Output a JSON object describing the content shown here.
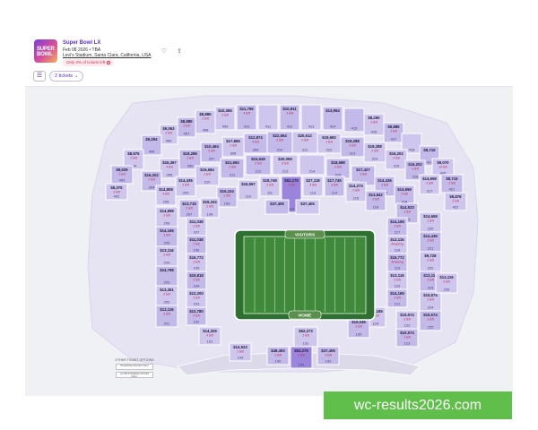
{
  "event": {
    "title": "Super Bowl LX",
    "date": "Feb 08 2026 • TBA",
    "venue": "Levi's Stadium, Santa Clara, California, USA",
    "tickets_left": "Only 3% of tickets left",
    "thumb_text": "SUPER BOWL"
  },
  "toolbar": {
    "ticket_count": "2 tickets"
  },
  "field": {
    "visitors": "VISITORS",
    "home": "HOME"
  },
  "other_options": {
    "title": "OTHER TICKET OPTIONS",
    "options": [
      "STANDING ROOM ONLY",
      "CLUB STANDING ROOM ONLY"
    ]
  },
  "watermark": "wc-results2026.com",
  "colors": {
    "accent": "#5b2bd6",
    "section": "#cfc6ee",
    "section_alt": "#c4bae9",
    "alert": "#c32047",
    "field_green": "#3f8a3a",
    "background": "#eff1f5"
  },
  "sections": [
    {
      "id": "409",
      "price": "$10,365",
      "left": "2 left"
    },
    {
      "id": "410",
      "price": "$11,755",
      "left": "4 left"
    },
    {
      "id": "411",
      "price": "",
      "left": ""
    },
    {
      "id": "412",
      "price": "$10,911",
      "left": "2 left"
    },
    {
      "id": "413",
      "price": "",
      "left": ""
    },
    {
      "id": "414",
      "price": "$13,964",
      "left": ""
    },
    {
      "id": "408",
      "price": "$8,885",
      "left": "2 left"
    },
    {
      "id": "407",
      "price": "$8,885",
      "left": "2 left"
    },
    {
      "id": "406",
      "price": "$9,063",
      "left": "2 left"
    },
    {
      "id": "405",
      "price": "$9,294",
      "left": ""
    },
    {
      "id": "404",
      "price": "$8,976",
      "left": "2 left"
    },
    {
      "id": "403",
      "price": "$8,529",
      "left": "2 left"
    },
    {
      "id": "402",
      "price": "$8,375",
      "left": "2 left"
    },
    {
      "id": "415",
      "price": "",
      "left": ""
    },
    {
      "id": "416",
      "price": "$8,250",
      "left": "2 left"
    },
    {
      "id": "417",
      "price": "$8,885",
      "left": "2 left"
    },
    {
      "id": "418",
      "price": "",
      "left": ""
    },
    {
      "id": "419",
      "price": "$8,715",
      "left": ""
    },
    {
      "id": "420",
      "price": "$9,070",
      "left": "14 left"
    },
    {
      "id": "421",
      "price": "$8,715",
      "left": "2 left"
    },
    {
      "id": "422",
      "price": "$8,878",
      "left": "2 left"
    },
    {
      "id": "310",
      "price": "$22,654",
      "left": "2 left"
    },
    {
      "id": "311",
      "price": "$20,612",
      "left": "2 left"
    },
    {
      "id": "309",
      "price": "$12,874",
      "left": "4 left"
    },
    {
      "id": "308",
      "price": "$17,865",
      "left": "2 left"
    },
    {
      "id": "307",
      "price": "$10,464",
      "left": "2 left"
    },
    {
      "id": "312",
      "price": "$19,692",
      "left": "2 left"
    },
    {
      "id": "313",
      "price": "$19,288",
      "left": "2 left"
    },
    {
      "id": "314",
      "price": "$19,288",
      "left": "2 left"
    },
    {
      "id": "306",
      "price": "$19,288",
      "left": "2 left"
    },
    {
      "id": "305",
      "price": "$16,367",
      "left": "4 left"
    },
    {
      "id": "304",
      "price": "$16,202",
      "left": "2 left"
    },
    {
      "id": "315",
      "price": "$16,202",
      "left": "2 left"
    },
    {
      "id": "316",
      "price": "$16,202",
      "left": "2 left"
    },
    {
      "id": "317",
      "price": "$14,659",
      "left": "2 left"
    },
    {
      "id": "212",
      "price": "$24,549",
      "left": "2 left"
    },
    {
      "id": "213",
      "price": "$30,069",
      "left": "6 left"
    },
    {
      "id": "211",
      "price": "$21,692",
      "left": "2 left"
    },
    {
      "id": "214",
      "price": "",
      "left": ""
    },
    {
      "id": "215",
      "price": "$18,588",
      "left": "2 left"
    },
    {
      "id": "210",
      "price": "$15,684",
      "left": "2 left"
    },
    {
      "id": "216",
      "price": "$17,427",
      "left": "2 left"
    },
    {
      "id": "209",
      "price": "$14,436",
      "left": "2 left"
    },
    {
      "id": "217",
      "price": "$14,436",
      "left": "2 left"
    },
    {
      "id": "208",
      "price": "$14,808",
      "left": "4 left"
    },
    {
      "id": "218",
      "price": "$14,659",
      "left": "2 left"
    },
    {
      "id": "111",
      "price": "$18,749",
      "left": "2 left"
    },
    {
      "id": "112",
      "price": "$52,275",
      "left": "2 left"
    },
    {
      "id": "113",
      "price": "$27,118",
      "left": "2 left"
    },
    {
      "id": "114",
      "price": "$17,745",
      "left": "2 left"
    },
    {
      "id": "110",
      "price": "$16,567",
      "left": ""
    },
    {
      "id": "109",
      "price": "$15,104",
      "left": "2 left"
    },
    {
      "id": "115",
      "price": "$14,273",
      "left": "2 left"
    },
    {
      "id": "116",
      "price": "$13,942",
      "left": "2 left"
    },
    {
      "id": "108",
      "price": "$15,104",
      "left": "2 left"
    },
    {
      "id": "C1",
      "price": "$37,405",
      "left": ""
    },
    {
      "id": "C2",
      "price": "$37,405",
      "left": ""
    },
    {
      "id": "207",
      "price": "$13,715",
      "left": "2 left"
    },
    {
      "id": "206",
      "price": "$14,659",
      "left": "2 left"
    },
    {
      "id": "205",
      "price": "$14,165",
      "left": "2 left"
    },
    {
      "id": "204",
      "price": "$13,116",
      "left": "2 left"
    },
    {
      "id": "203",
      "price": "$24,798",
      "left": ""
    },
    {
      "id": "202",
      "price": "$13,361",
      "left": "2 left"
    },
    {
      "id": "201",
      "price": "$13,116",
      "left": "2 left"
    },
    {
      "id": "107",
      "price": "$11,038",
      "left": "2 left"
    },
    {
      "id": "106",
      "price": "$11,038",
      "left": "2 left"
    },
    {
      "id": "105",
      "price": "$16,772",
      "left": "2 left"
    },
    {
      "id": "104",
      "price": "$15,818",
      "left": "2 left"
    },
    {
      "id": "103",
      "price": "$12,200",
      "left": "2 left"
    },
    {
      "id": "102",
      "price": "$12,780",
      "left": "2 left"
    },
    {
      "id": "101",
      "price": "$14,329",
      "left": "4 left"
    },
    {
      "id": "219",
      "price": "$14,523",
      "left": "2 left"
    },
    {
      "id": "220",
      "price": "$14,659",
      "left": "2 left"
    },
    {
      "id": "221",
      "price": "$14,436",
      "left": "2 left"
    },
    {
      "id": "222",
      "price": "$9,728",
      "left": "2 left"
    },
    {
      "id": "223",
      "price": "$13,116",
      "left": "2 left"
    },
    {
      "id": "224",
      "price": "$15,574",
      "left": "2 left"
    },
    {
      "id": "225",
      "price": "$15,574",
      "left": "2 left"
    },
    {
      "id": "226",
      "price": "$13,116",
      "left": "2 left"
    },
    {
      "id": "117",
      "price": "$14,165",
      "left": "2 left"
    },
    {
      "id": "118",
      "price": "$13,116",
      "left": "Amazing"
    },
    {
      "id": "119",
      "price": "$16,772",
      "left": "Amazing"
    },
    {
      "id": "120",
      "price": "$13,116",
      "left": "2 left"
    },
    {
      "id": "121",
      "price": "$14,165",
      "left": "2 left"
    },
    {
      "id": "122",
      "price": "$15,574",
      "left": "2 left"
    },
    {
      "id": "123",
      "price": "$10,574",
      "left": "2 left"
    },
    {
      "id": "124",
      "price": "$14,185",
      "left": "2 left"
    },
    {
      "id": "130",
      "price": "$15,045",
      "left": "2 left"
    },
    {
      "id": "131",
      "price": "$52,273",
      "left": "2 left"
    },
    {
      "id": "140",
      "price": "$48,493",
      "left": "2 left"
    },
    {
      "id": "141",
      "price": "$52,275",
      "left": "2 left"
    },
    {
      "id": "142",
      "price": "$37,405",
      "left": "4 left"
    },
    {
      "id": "143",
      "price": "$14,523",
      "left": "2 left"
    }
  ]
}
